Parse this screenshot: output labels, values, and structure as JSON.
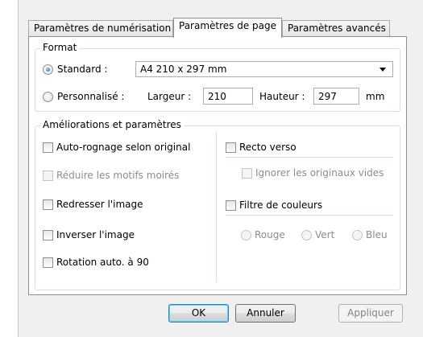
{
  "tabs": [
    {
      "label": "Paramètres de numérisation"
    },
    {
      "label": "Paramètres de page"
    },
    {
      "label": "Paramètres avancés"
    }
  ],
  "format": {
    "title": "Format",
    "standard_label": "Standard :",
    "standard_value": "A4 210 x 297 mm",
    "custom_label": "Personnalisé :",
    "width_label": "Largeur :",
    "width_value": "210",
    "height_label": "Hauteur :",
    "height_value": "297",
    "unit": "mm"
  },
  "improvements": {
    "title": "Améliorations et paramètres",
    "left": [
      {
        "label": "Auto-rognage selon original"
      },
      {
        "label": "Réduire les motifs moirés"
      },
      {
        "label": "Redresser l'image"
      },
      {
        "label": "Inverser l'image"
      },
      {
        "label": "Rotation auto. à 90"
      }
    ],
    "duplex": "Recto verso",
    "ignore_blank": "Ignorer les originaux vides",
    "color_filter": "Filtre de couleurs",
    "colors": [
      {
        "label": "Rouge"
      },
      {
        "label": "Vert"
      },
      {
        "label": "Bleu"
      }
    ]
  },
  "buttons": {
    "ok": "OK",
    "cancel": "Annuler",
    "apply": "Appliquer"
  }
}
